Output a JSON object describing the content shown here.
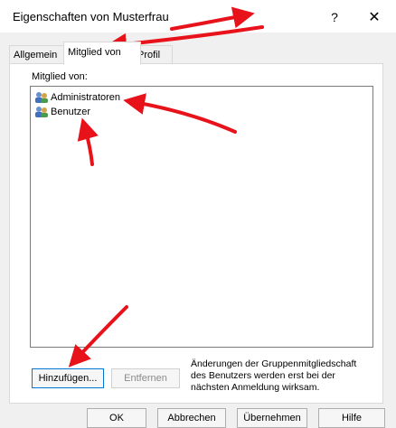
{
  "window": {
    "title": "Eigenschaften von Musterfrau",
    "help_glyph": "?",
    "close_glyph": "✕"
  },
  "tabs": [
    {
      "label": "Allgemein",
      "active": false
    },
    {
      "label": "Mitglied von",
      "active": true
    },
    {
      "label": "Profil",
      "active": false
    }
  ],
  "member_of": {
    "label": "Mitglied von:",
    "items": [
      {
        "name": "Administratoren",
        "icon": "group-icon"
      },
      {
        "name": "Benutzer",
        "icon": "group-icon"
      }
    ]
  },
  "actions": {
    "add_label": "Hinzufügen...",
    "remove_label": "Entfernen",
    "remove_enabled": false
  },
  "hint": "Änderungen der Gruppenmitgliedschaft des Benutzers werden erst bei der nächsten Anmeldung wirksam.",
  "footer": {
    "ok": "OK",
    "cancel": "Abbrechen",
    "apply": "Übernehmen",
    "help": "Hilfe"
  },
  "colors": {
    "arrow": "#e8121b",
    "focus_border": "#0078d7"
  }
}
